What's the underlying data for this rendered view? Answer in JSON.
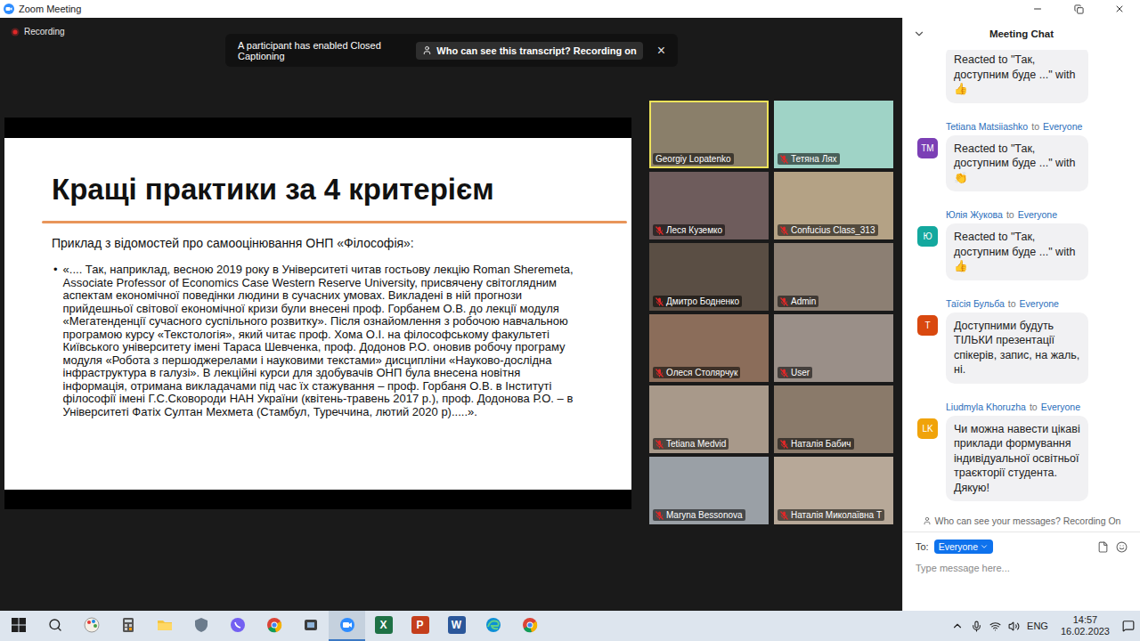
{
  "window": {
    "title": "Zoom Meeting"
  },
  "recording": {
    "label": "Recording"
  },
  "banner": {
    "message": "A participant has enabled Closed Captioning",
    "link": "Who can see this transcript? Recording on",
    "close": "×"
  },
  "slide": {
    "title": "Кращі практики за 4 критерієм",
    "subtitle": "Приклад з відомостей про самооцінювання ОНП «Філософія»:",
    "bullets": [
      {
        "marker": "•",
        "text": "«.... Так, наприклад, весною 2019 року в Університеті читав гостьову лекцію Roman Sheremeta, Associate Professor of Economics Case Western Reserve University, присвячену світоглядним аспектам економічної поведінки людини в сучасних умовах. Викладені в ній прогнози прийдешньої світової економічної кризи були внесені проф. Горбанем О.В. до лекції модуля «Мегатенденції сучасного суспільного розвитку». Після ознайомлення з робочою навчальною програмою курсу «Текстологія», який читає проф. Хома О.І. на філософському факультеті Київського університету імені Тараса Шевченка, проф. Додонов Р.О. оновив робочу програму модуля «Робота з першоджерелами і науковими текстами» дисципліни «Науково-дослідна інфраструктура в галузі». В лекційні курси для здобувачів ОНП була внесена новітня інформація, отримана викладачами під час їх стажування – проф. Горбаня О.В. в Інституті філософії імені Г.С.Сковороди НАН України (квітень-травень 2017 р.), проф. Додонова Р.О. – в Університеті Фатіх Султан Мехмета (Стамбул, Туреччина, лютий 2020 р).....»."
      }
    ]
  },
  "participants": [
    {
      "name": "Georgiy Lopatenko",
      "muted": false,
      "active": true,
      "color": "#8a7f6a"
    },
    {
      "name": "Тетяна Лях",
      "muted": true,
      "active": false,
      "color": "#9fd3c6"
    },
    {
      "name": "Леся Куземко",
      "muted": true,
      "active": false,
      "color": "#6e5c5c"
    },
    {
      "name": "Confucius Class_313",
      "muted": true,
      "active": false,
      "color": "#b4a285"
    },
    {
      "name": "Дмитро Бодненко",
      "muted": true,
      "active": false,
      "color": "#5a4e44"
    },
    {
      "name": "Admin",
      "muted": true,
      "active": false,
      "color": "#8c7f73"
    },
    {
      "name": "Олеся Столярчук",
      "muted": true,
      "active": false,
      "color": "#8b6d5a"
    },
    {
      "name": "User",
      "muted": true,
      "active": false,
      "color": "#9a8f88"
    },
    {
      "name": "Tetiana Medvid",
      "muted": true,
      "active": false,
      "color": "#a8998a"
    },
    {
      "name": "Наталія Бабич",
      "muted": true,
      "active": false,
      "color": "#8a7a6a"
    },
    {
      "name": "Maryna Bessonova",
      "muted": true,
      "active": false,
      "color": "#9aa0a6"
    },
    {
      "name": "Наталія Миколаївна Т",
      "muted": true,
      "active": false,
      "color": "#b7a898"
    }
  ],
  "chat": {
    "title": "Meeting Chat",
    "messages": [
      {
        "kind": "continued",
        "sender": "",
        "to": "",
        "recipient": "",
        "initials": "",
        "color": "#ffffff",
        "text": "Reacted to \"Так, доступним буде ...\" with 👍"
      },
      {
        "kind": "message",
        "sender": "Tetiana Matsiiashko",
        "to": "to",
        "recipient": "Everyone",
        "initials": "TM",
        "color": "#7b3fb5",
        "text": "Reacted to \"Так, доступним буде ...\" with 👏"
      },
      {
        "kind": "message",
        "sender": "Юлія Жукова",
        "to": "to",
        "recipient": "Everyone",
        "initials": "Ю",
        "color": "#13a89e",
        "text": "Reacted to \"Так, доступним буде ...\" with 👍"
      },
      {
        "kind": "message",
        "sender": "Таїсія Бульба",
        "to": "to",
        "recipient": "Everyone",
        "initials": "T",
        "color": "#d9480f",
        "text": "Доступними будуть ТІЛЬКИ презентації спікерів, запис, на жаль, ні."
      },
      {
        "kind": "message",
        "sender": "Liudmyla Khoruzha",
        "to": "to",
        "recipient": "Everyone",
        "initials": "LK",
        "color": "#f0a30a",
        "text": "Чи можна навести цікаві приклади формування індивідуальної освітньої траєкторії студента. Дякую!"
      }
    ],
    "privacy": "Who can see your messages? Recording On",
    "to_label": "To:",
    "recipient": "Everyone",
    "placeholder": "Type message here..."
  },
  "taskbar": {
    "apps": [
      {
        "kind": "paint",
        "glyph": "",
        "active": false
      },
      {
        "kind": "calculator",
        "glyph": "",
        "active": false
      },
      {
        "kind": "folder",
        "glyph": "",
        "active": false
      },
      {
        "kind": "shield",
        "glyph": "",
        "active": false
      },
      {
        "kind": "viber",
        "glyph": "",
        "active": false
      },
      {
        "kind": "chrome",
        "glyph": "",
        "active": false
      },
      {
        "kind": "app",
        "glyph": "",
        "active": false
      },
      {
        "kind": "zoom",
        "glyph": "",
        "active": true
      },
      {
        "kind": "excel",
        "glyph": "X",
        "active": false
      },
      {
        "kind": "powerpoint",
        "glyph": "P",
        "active": false
      },
      {
        "kind": "word",
        "glyph": "W",
        "active": false
      },
      {
        "kind": "edge",
        "glyph": "",
        "active": false
      },
      {
        "kind": "chrome",
        "glyph": "",
        "active": false
      }
    ],
    "lang": "ENG",
    "time": "14:57",
    "date": "16.02.2023"
  }
}
